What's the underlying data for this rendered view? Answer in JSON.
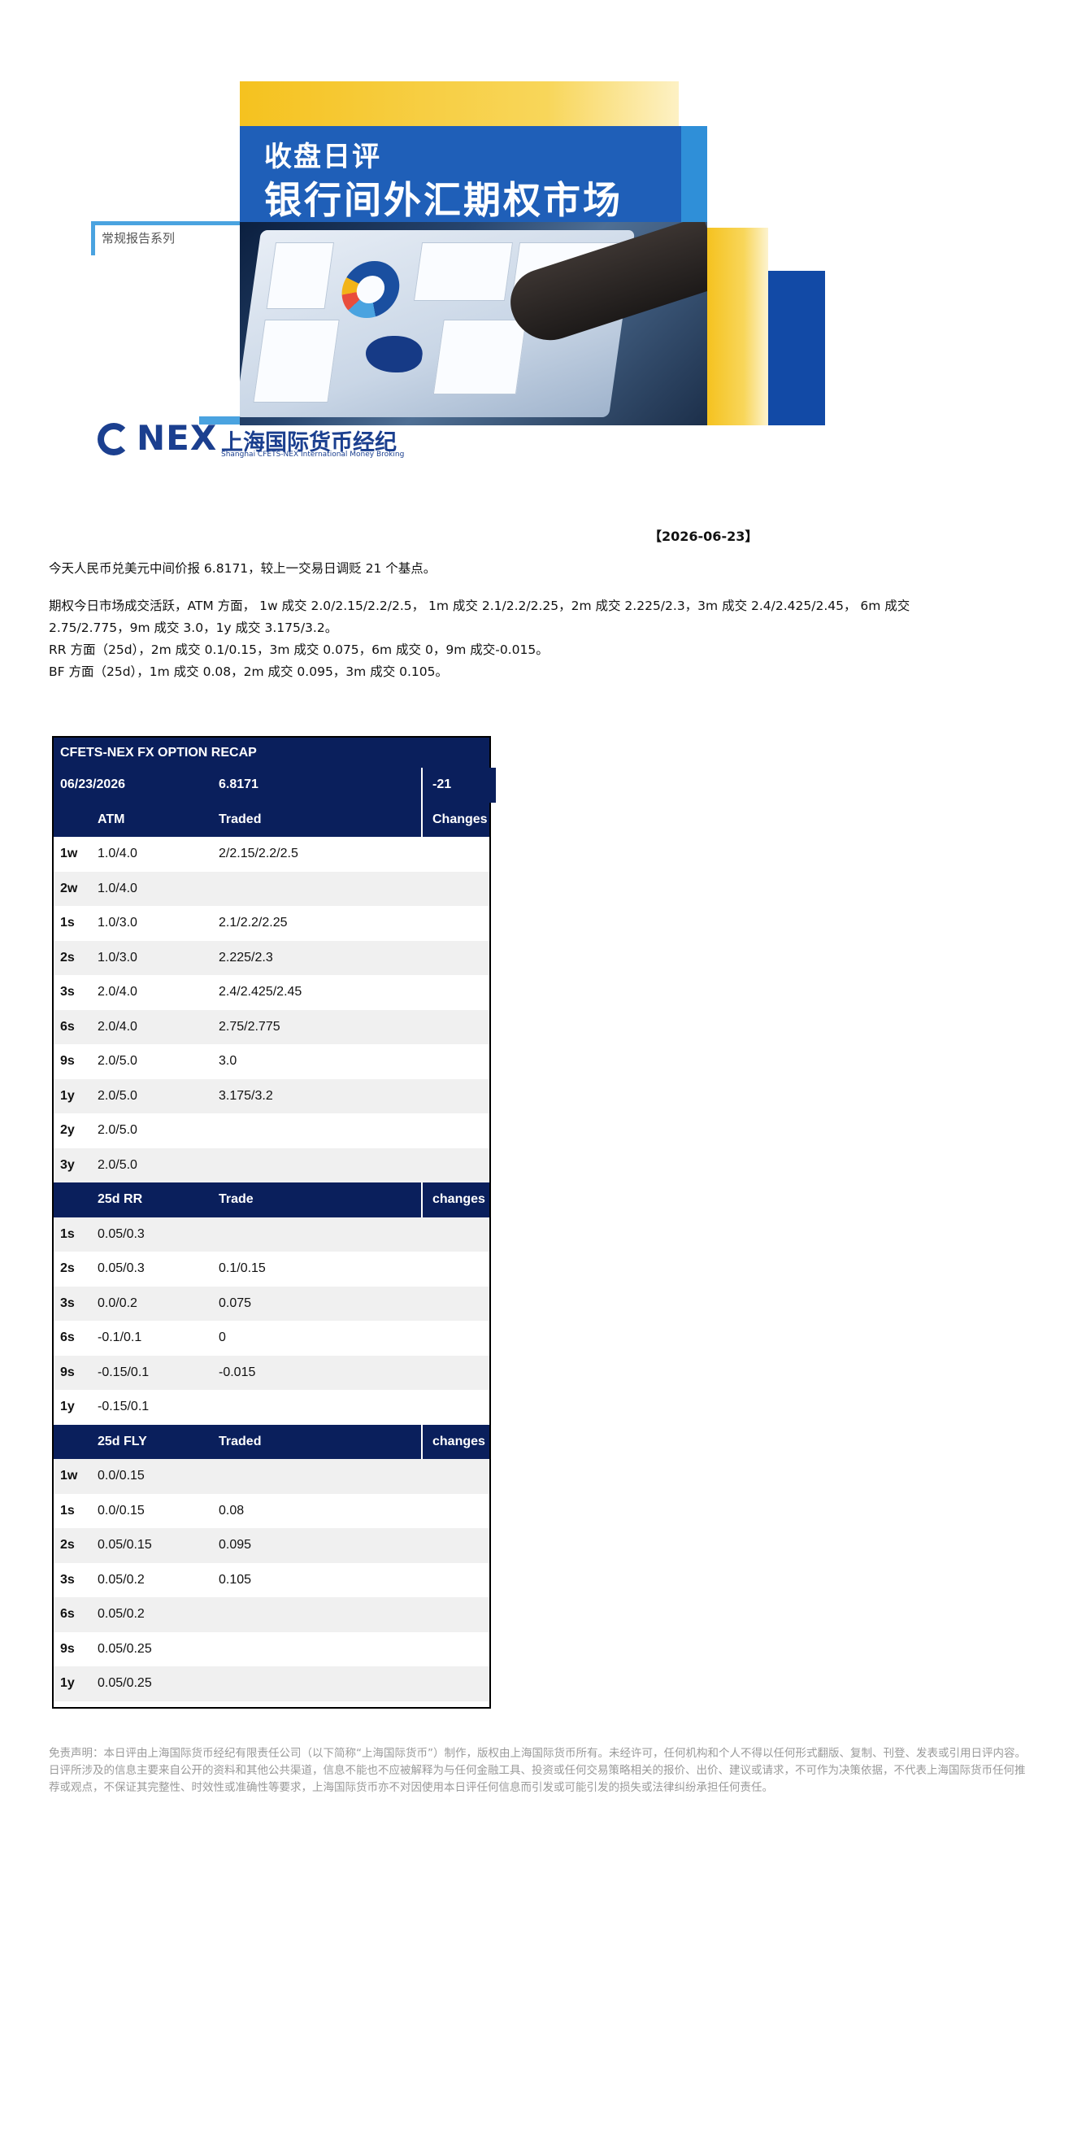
{
  "banner": {
    "title_small": "收盘日评",
    "title_large": "银行间外汇期权市场",
    "series_label": "常规报告系列",
    "logo_nex": "NEX",
    "logo_cn": "上海国际货币经纪",
    "logo_en": "Shanghai CFETS-NEX International Money Broking"
  },
  "report": {
    "date": "【2026-06-23】",
    "paragraph1": "今天人民币兑美元中间价报 6.8171，较上一交易日调贬 21 个基点。",
    "paragraph2_line1": "期权今日市场成交活跃，ATM 方面， 1w 成交 2.0/2.15/2.2/2.5， 1m 成交 2.1/2.2/2.25，2m 成交 2.225/2.3，3m 成交 2.4/2.425/2.45， 6m 成交",
    "paragraph2_line2": "2.75/2.775，9m 成交 3.0，1y 成交 3.175/3.2。",
    "paragraph2_line3": "RR 方面（25d），2m 成交 0.1/0.15，3m 成交 0.075，6m 成交 0，9m 成交-0.015。",
    "paragraph2_line4": "BF 方面（25d），1m 成交 0.08，2m 成交 0.095，3m 成交 0.105。"
  },
  "table": {
    "title": "CFETS-NEX FX OPTION RECAP",
    "info": {
      "date": "06/23/2026",
      "fixing": "6.8171",
      "change": "-21"
    },
    "atm": {
      "header": {
        "quote": "ATM",
        "traded": "Traded",
        "changes": "Changes"
      },
      "rows": [
        {
          "tenor": "1w",
          "quote": "1.0/4.0",
          "traded": "2/2.15/2.2/2.5"
        },
        {
          "tenor": "2w",
          "quote": "1.0/4.0",
          "traded": ""
        },
        {
          "tenor": "1s",
          "quote": "1.0/3.0",
          "traded": "2.1/2.2/2.25"
        },
        {
          "tenor": "2s",
          "quote": "1.0/3.0",
          "traded": "2.225/2.3"
        },
        {
          "tenor": "3s",
          "quote": "2.0/4.0",
          "traded": "2.4/2.425/2.45"
        },
        {
          "tenor": "6s",
          "quote": "2.0/4.0",
          "traded": "2.75/2.775"
        },
        {
          "tenor": "9s",
          "quote": "2.0/5.0",
          "traded": "3.0"
        },
        {
          "tenor": "1y",
          "quote": "2.0/5.0",
          "traded": "3.175/3.2"
        },
        {
          "tenor": "2y",
          "quote": "2.0/5.0",
          "traded": ""
        },
        {
          "tenor": "3y",
          "quote": "2.0/5.0",
          "traded": ""
        }
      ]
    },
    "rr": {
      "header": {
        "quote": "25d RR",
        "traded": "Trade",
        "changes": "changes"
      },
      "rows": [
        {
          "tenor": "1s",
          "quote": "0.05/0.3",
          "traded": ""
        },
        {
          "tenor": "2s",
          "quote": "0.05/0.3",
          "traded": "0.1/0.15"
        },
        {
          "tenor": "3s",
          "quote": "0.0/0.2",
          "traded": "0.075"
        },
        {
          "tenor": "6s",
          "quote": "-0.1/0.1",
          "traded": "0"
        },
        {
          "tenor": "9s",
          "quote": "-0.15/0.1",
          "traded": "-0.015"
        },
        {
          "tenor": "1y",
          "quote": "-0.15/0.1",
          "traded": ""
        }
      ]
    },
    "fly": {
      "header": {
        "quote": "25d FLY",
        "traded": "Traded",
        "changes": "changes"
      },
      "rows": [
        {
          "tenor": "1w",
          "quote": "0.0/0.15",
          "traded": ""
        },
        {
          "tenor": "1s",
          "quote": "0.0/0.15",
          "traded": "0.08"
        },
        {
          "tenor": "2s",
          "quote": "0.05/0.15",
          "traded": "0.095"
        },
        {
          "tenor": "3s",
          "quote": "0.05/0.2",
          "traded": "0.105"
        },
        {
          "tenor": "6s",
          "quote": "0.05/0.2",
          "traded": ""
        },
        {
          "tenor": "9s",
          "quote": "0.05/0.25",
          "traded": ""
        },
        {
          "tenor": "1y",
          "quote": "0.05/0.25",
          "traded": ""
        }
      ]
    }
  },
  "disclaimer": "免责声明：本日评由上海国际货币经纪有限责任公司（以下简称“上海国际货币”）制作，版权由上海国际货币所有。未经许可，任何机构和个人不得以任何形式翻版、复制、刊登、发表或引用日评内容。日评所涉及的信息主要来自公开的资料和其他公共渠道，信息不能也不应被解释为与任何金融工具、投资或任何交易策略相关的报价、出价、建议或请求，不可作为决策依据，不代表上海国际货币任何推荐或观点，不保证其完整性、时效性或准确性等要求，上海国际货币亦不对因使用本日评任何信息而引发或可能引发的损失或法律纠纷承担任何责任。",
  "colors": {
    "navy": "#0a1f5c",
    "banner_blue": "#1f5fb8",
    "banner_yellow": "#f5c21f",
    "stripe": "#f0f0f0"
  }
}
